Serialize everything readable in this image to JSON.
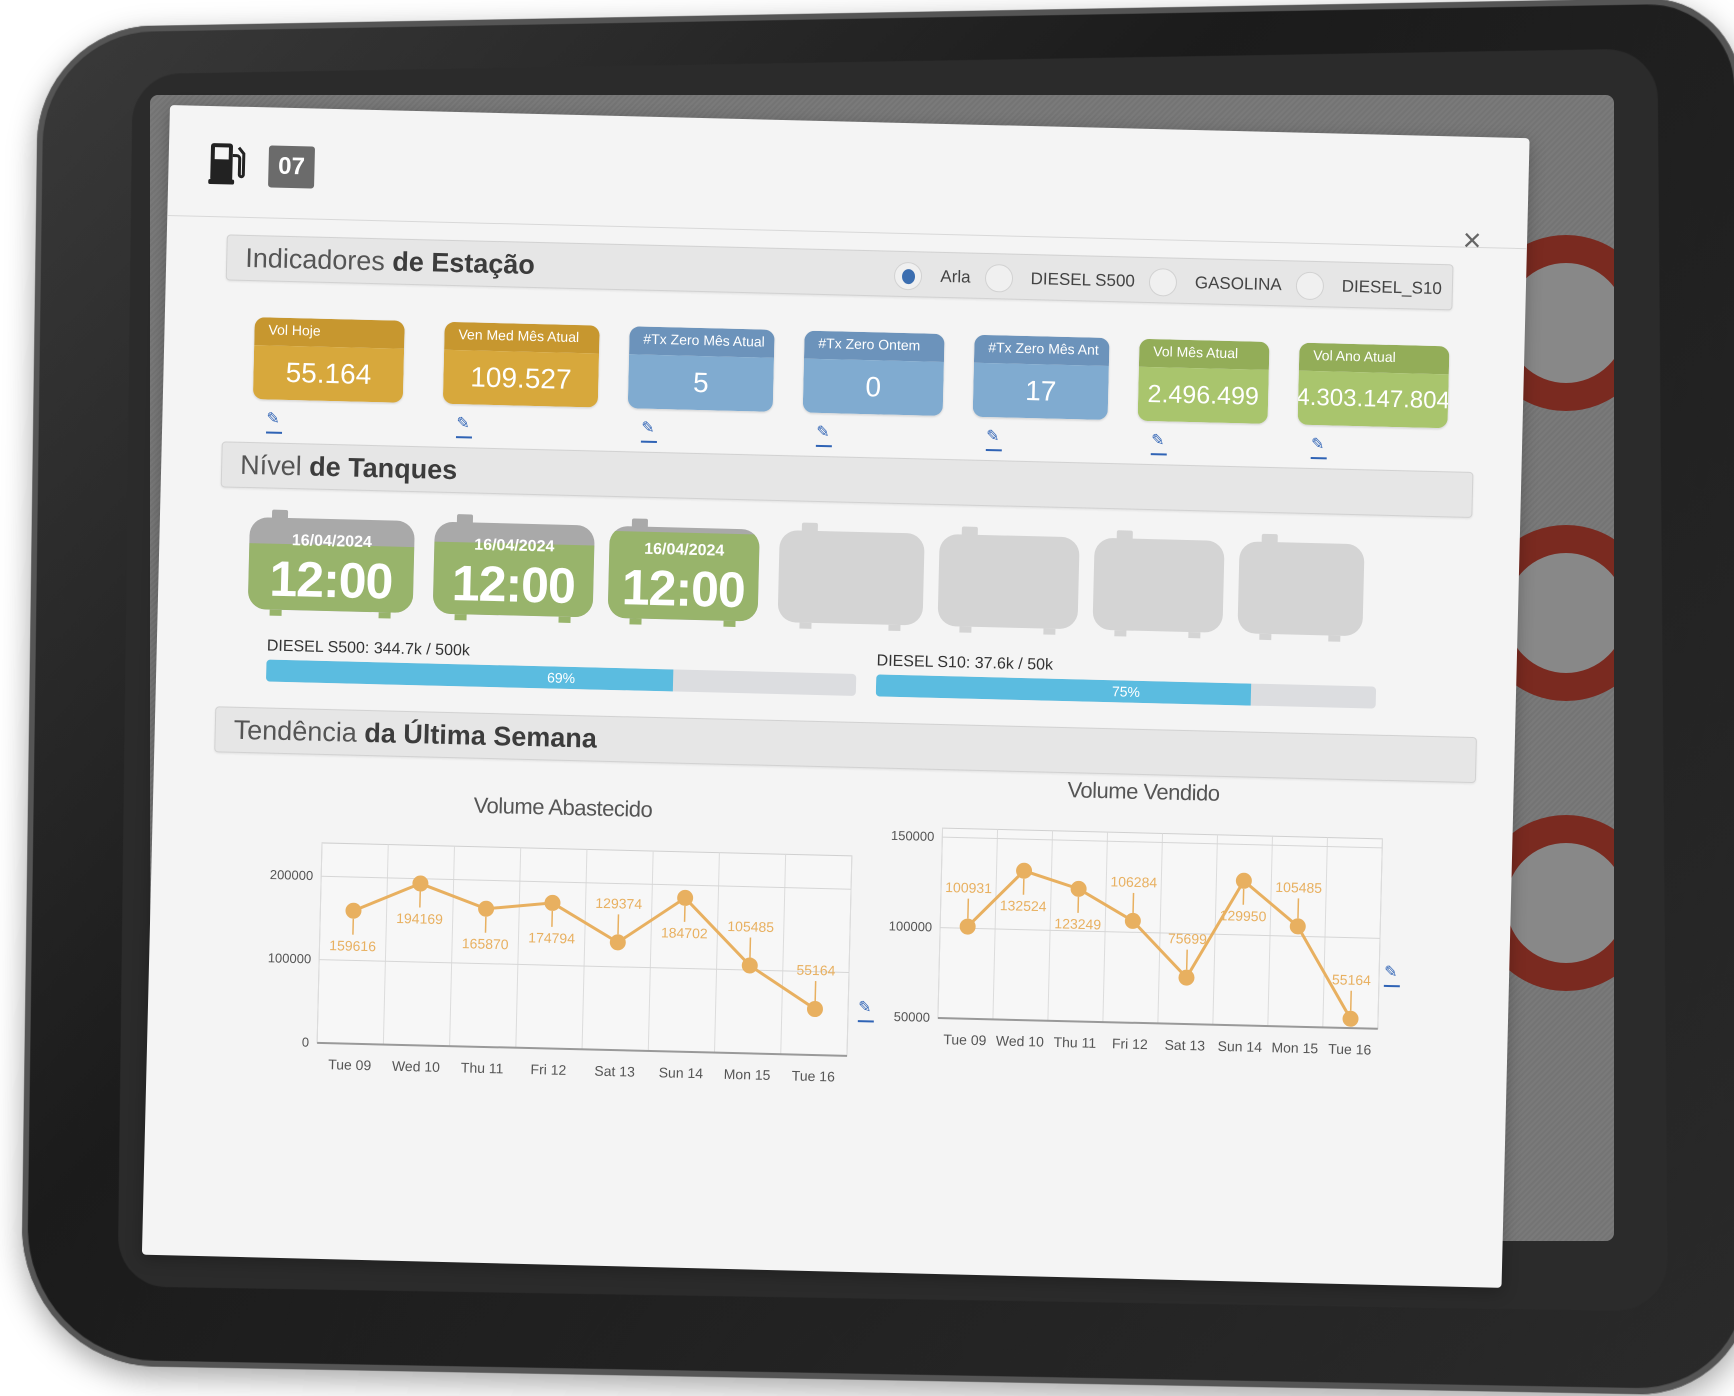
{
  "header": {
    "station_icon": "fuel-pump-icon",
    "station_number": "07",
    "close_icon": "close-icon",
    "close_glyph": "×"
  },
  "indicators": {
    "title_light": "Indicadores",
    "title_bold": "de Estação",
    "fuel_options": [
      {
        "label": "Arla",
        "selected": true
      },
      {
        "label": "DIESEL S500",
        "selected": false
      },
      {
        "label": "GASOLINA",
        "selected": false
      },
      {
        "label": "DIESEL_S10",
        "selected": false
      }
    ],
    "kpis": [
      {
        "label": "Vol Hoje",
        "value": "55.164",
        "color": "gold"
      },
      {
        "label": "Ven Med Mês Atual",
        "value": "109.527",
        "color": "gold"
      },
      {
        "label": "#Tx Zero Mês Atual",
        "value": "5",
        "color": "blue"
      },
      {
        "label": "#Tx Zero Ontem",
        "value": "0",
        "color": "blue"
      },
      {
        "label": "#Tx Zero Mês Ant",
        "value": "17",
        "color": "blue"
      },
      {
        "label": "Vol Mês Atual",
        "value": "2.496.499",
        "color": "green"
      },
      {
        "label": "Vol Ano Atual",
        "value": "4.303.147.804",
        "color": "green"
      }
    ],
    "edit_icon": "pencil-icon",
    "colors": {
      "gold": "#d7a83c",
      "blue": "#80abd0",
      "green": "#a9c56d"
    }
  },
  "tanks": {
    "title_light": "Nível",
    "title_bold": "de Tanques",
    "items": [
      {
        "date": "16/04/2024",
        "time": "12:00",
        "fill": 0.72,
        "active": true
      },
      {
        "date": "16/04/2024",
        "time": "12:00",
        "fill": 0.78,
        "active": true
      },
      {
        "date": "16/04/2024",
        "time": "12:00",
        "fill": 0.95,
        "active": true
      },
      {
        "date": "",
        "time": "",
        "fill": 0,
        "active": false
      },
      {
        "date": "",
        "time": "",
        "fill": 0,
        "active": false
      },
      {
        "date": "",
        "time": "",
        "fill": 0,
        "active": false
      },
      {
        "date": "",
        "time": "",
        "fill": 0,
        "active": false
      }
    ],
    "levels": [
      {
        "label": "DIESEL S500: 344.7k / 500k",
        "percent": 69,
        "percent_label": "69%"
      },
      {
        "label": "DIESEL S10: 37.6k / 50k",
        "percent": 75,
        "percent_label": "75%"
      }
    ],
    "colors": {
      "fill": "#98b46b",
      "empty": "#a9a9a9",
      "bar": "#5bbce0"
    }
  },
  "trend": {
    "title_light": "Tendência",
    "title_bold": "da Última Semana"
  },
  "chart_data": [
    {
      "type": "line",
      "title": "Volume Abastecido",
      "categories": [
        "Tue 09",
        "Wed 10",
        "Thu 11",
        "Fri 12",
        "Sat 13",
        "Sun 14",
        "Mon 15",
        "Tue 16"
      ],
      "series": [
        {
          "name": "Volume Abastecido",
          "values": [
            159616,
            194169,
            165870,
            174794,
            129374,
            184702,
            105485,
            55164
          ],
          "color": "#e8b060"
        }
      ],
      "data_labels": [
        "159616",
        "194169",
        "165870",
        "174794",
        "129374",
        "184702",
        "105485",
        "55164"
      ],
      "label_position": [
        "below",
        "below",
        "below",
        "below",
        "above",
        "below",
        "above",
        "above"
      ],
      "yticks": [
        0,
        100000,
        200000
      ],
      "ytick_labels": [
        "0",
        "100000",
        "200000"
      ],
      "ylim": [
        0,
        240000
      ],
      "xlabel": "",
      "ylabel": "",
      "grid": true,
      "legend": "none"
    },
    {
      "type": "line",
      "title": "Volume Vendido",
      "categories": [
        "Tue 09",
        "Wed 10",
        "Thu 11",
        "Fri 12",
        "Sat 13",
        "Sun 14",
        "Mon 15",
        "Tue 16"
      ],
      "series": [
        {
          "name": "Volume Vendido",
          "values": [
            100931,
            132524,
            123249,
            106284,
            75699,
            129950,
            105485,
            55164
          ],
          "color": "#e8b060"
        }
      ],
      "data_labels": [
        "100931",
        "132524",
        "123249",
        "106284",
        "75699",
        "129950",
        "105485",
        "55164"
      ],
      "label_position": [
        "above",
        "below",
        "below",
        "above",
        "above",
        "below",
        "above",
        "above"
      ],
      "yticks": [
        50000,
        100000,
        150000
      ],
      "ytick_labels": [
        "50000",
        "100000",
        "150000"
      ],
      "ylim": [
        50000,
        155000
      ],
      "xlabel": "",
      "ylabel": "",
      "grid": true,
      "legend": "none"
    }
  ]
}
